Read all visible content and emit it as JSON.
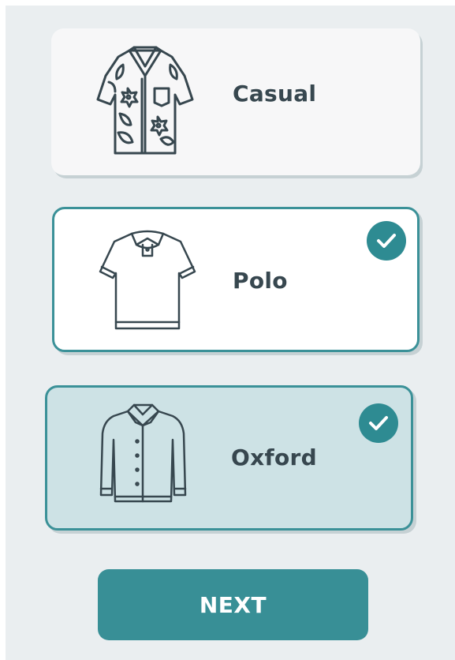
{
  "colors": {
    "panel_background": "#eaeef0",
    "accent": "#388f96",
    "selected_tint": "#cde2e5",
    "text": "#37474f"
  },
  "options": [
    {
      "id": "casual",
      "label": "Casual",
      "icon": "hawaiian-shirt-icon",
      "selected": false
    },
    {
      "id": "polo",
      "label": "Polo",
      "icon": "polo-shirt-icon",
      "selected": true
    },
    {
      "id": "oxford",
      "label": "Oxford",
      "icon": "oxford-shirt-icon",
      "selected": true
    }
  ],
  "next_button": {
    "label": "NEXT"
  }
}
